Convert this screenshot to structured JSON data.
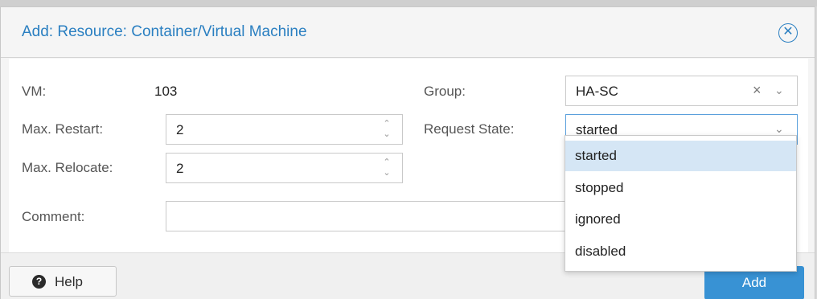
{
  "dialog": {
    "title": "Add: Resource: Container/Virtual Machine",
    "close_icon": "close-circle-icon"
  },
  "form": {
    "vm_label": "VM:",
    "vm_value": "103",
    "max_restart_label": "Max. Restart:",
    "max_restart_value": "2",
    "max_relocate_label": "Max. Relocate:",
    "max_relocate_value": "2",
    "comment_label": "Comment:",
    "comment_value": "",
    "group_label": "Group:",
    "group_value": "HA-SC",
    "request_state_label": "Request State:",
    "request_state_value": "started"
  },
  "dropdown": {
    "options": [
      "started",
      "stopped",
      "ignored",
      "disabled"
    ],
    "selected": "started"
  },
  "footer": {
    "help_label": "Help",
    "add_label": "Add"
  },
  "colors": {
    "accent": "#2a7fc1",
    "primary_button": "#3892d4",
    "selected_option": "#d5e6f5"
  }
}
